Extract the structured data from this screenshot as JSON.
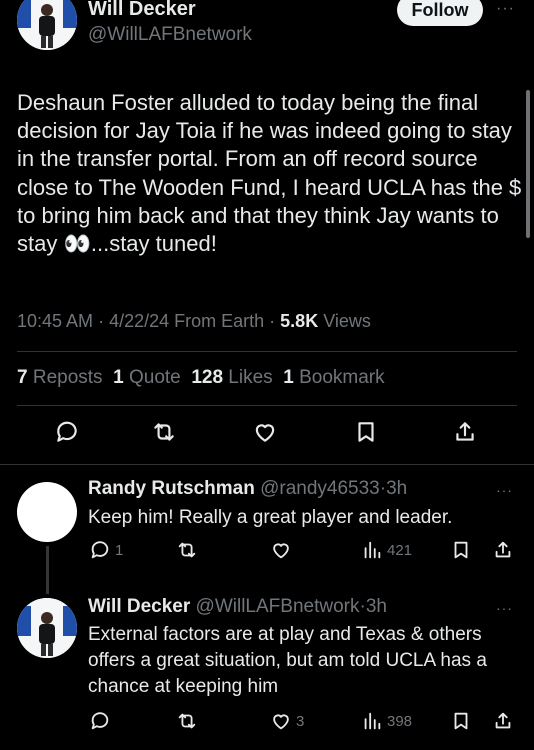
{
  "main_tweet": {
    "author_name": "Will Decker",
    "author_handle": "@WillLAFBnetwork",
    "follow_label": "Follow",
    "more_glyph": "···",
    "text": "Deshaun Foster alluded to today being the final decision for Jay Toia if he was indeed going to stay in the transfer portal.  From an off record source close to The Wooden Fund, I heard UCLA has the $ to bring him back and that they think Jay wants to stay 👀...stay tuned!",
    "time": "10:45 AM",
    "date": "4/22/24",
    "source": "From Earth",
    "views_count": "5.8K",
    "views_label": "Views",
    "reposts_count": "7",
    "reposts_label": "Reposts",
    "quotes_count": "1",
    "quotes_label": "Quote",
    "likes_count": "128",
    "likes_label": "Likes",
    "bookmarks_count": "1",
    "bookmarks_label": "Bookmark"
  },
  "replies": [
    {
      "author_name": "Randy Rutschman",
      "author_handle": "@randy46533",
      "time": "3h",
      "text": "Keep him! Really a great player and leader.",
      "reply_count": "1",
      "repost_count": "",
      "like_count": "",
      "view_count": "421"
    },
    {
      "author_name": "Will Decker",
      "author_handle": "@WillLAFBnetwork",
      "time": "3h",
      "text": "External factors are at play and Texas & others offers a great situation, but am told UCLA has a chance at keeping him",
      "reply_count": "",
      "repost_count": "",
      "like_count": "3",
      "view_count": "398"
    }
  ],
  "colors": {
    "background": "#000000",
    "text_primary": "#e7e9ea",
    "text_secondary": "#71767b",
    "divider": "#2f3336",
    "follow_bg": "#eff3f4"
  },
  "icons": [
    "reply-icon",
    "repost-icon",
    "like-icon",
    "bookmark-icon",
    "share-icon",
    "views-icon",
    "more-icon"
  ]
}
